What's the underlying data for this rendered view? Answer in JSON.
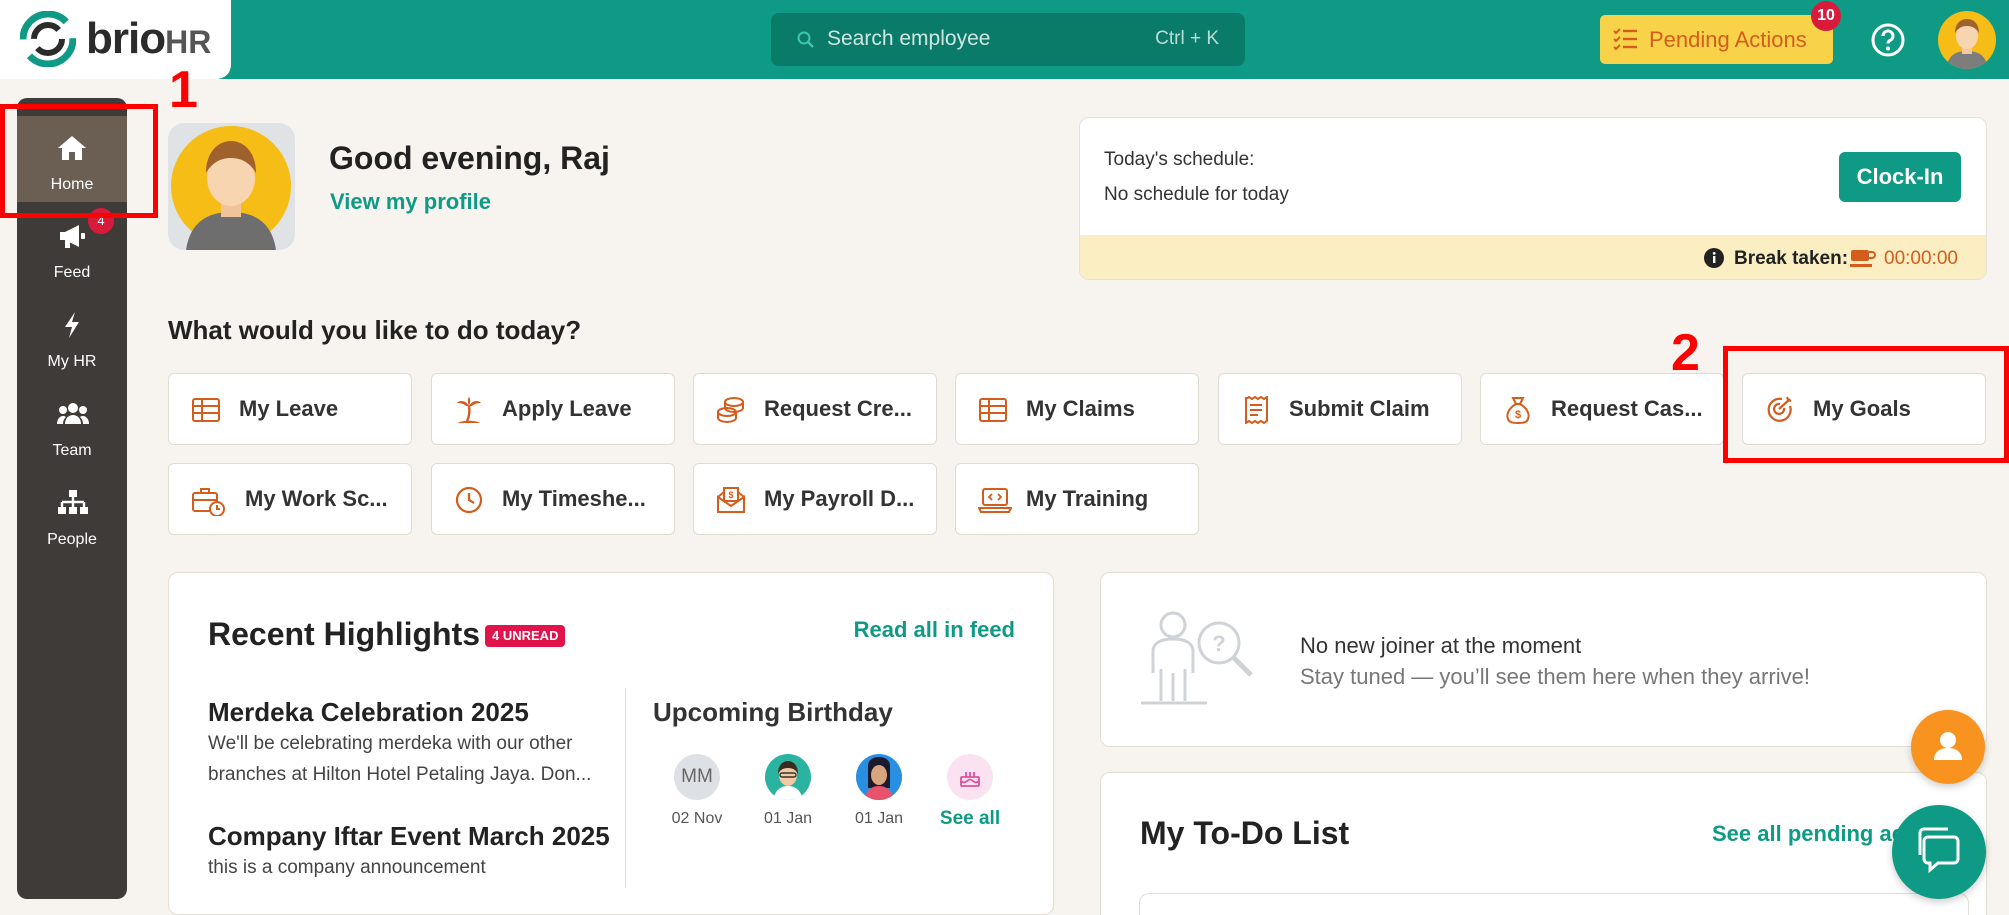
{
  "brand": {
    "name": "brio",
    "suffix": "HR",
    "color": "#0f9a85"
  },
  "topbar": {
    "search_placeholder": "Search employee",
    "search_shortcut": "Ctrl + K",
    "pending_label": "Pending Actions",
    "pending_count": "10",
    "help_icon": "question-circle-icon"
  },
  "sidebar": {
    "items": [
      {
        "label": "Home",
        "icon": "home-icon",
        "active": true
      },
      {
        "label": "Feed",
        "icon": "megaphone-icon",
        "badge": "4"
      },
      {
        "label": "My HR",
        "icon": "lightning-icon"
      },
      {
        "label": "Team",
        "icon": "team-icon"
      },
      {
        "label": "People",
        "icon": "org-chart-icon"
      }
    ]
  },
  "annotations": {
    "marker_1": "1",
    "marker_2": "2",
    "color": "#ff0000"
  },
  "greeting": {
    "text": "Good evening, Raj",
    "profile_link": "View my profile"
  },
  "schedule": {
    "title": "Today's schedule:",
    "detail": "No schedule for today",
    "clock_in": "Clock-In",
    "break_label": "Break taken:",
    "break_time": "00:00:00"
  },
  "quick_actions": {
    "title": "What would you like to do today?",
    "tiles": [
      {
        "label": "My Leave",
        "icon": "table-icon"
      },
      {
        "label": "Apply Leave",
        "icon": "palm-tree-icon"
      },
      {
        "label": "Request Cre...",
        "icon": "coins-icon"
      },
      {
        "label": "My Claims",
        "icon": "table-icon"
      },
      {
        "label": "Submit Claim",
        "icon": "receipt-icon"
      },
      {
        "label": "Request Cas...",
        "icon": "money-bag-icon"
      },
      {
        "label": "My Goals",
        "icon": "target-icon"
      },
      {
        "label": "My Work Sc...",
        "icon": "briefcase-clock-icon"
      },
      {
        "label": "My Timeshe...",
        "icon": "clock-icon"
      },
      {
        "label": "My Payroll D...",
        "icon": "payroll-envelope-icon"
      },
      {
        "label": "My Training",
        "icon": "laptop-code-icon"
      }
    ]
  },
  "highlights": {
    "title": "Recent Highlights",
    "unread": "4 UNREAD",
    "read_all": "Read all in feed",
    "news": [
      {
        "title": "Merdeka Celebration 2025",
        "line1": "We'll be celebrating merdeka with our other",
        "line2": "branches at Hilton Hotel Petaling Jaya. Don..."
      },
      {
        "title": "Company Iftar Event March 2025",
        "line1": "this is a company announcement"
      }
    ],
    "birthday": {
      "title": "Upcoming Birthday",
      "people": [
        {
          "initials": "MM",
          "date": "02 Nov"
        },
        {
          "date": "01 Jan"
        },
        {
          "date": "01 Jan"
        }
      ],
      "see_all": "See all"
    }
  },
  "joiner": {
    "title": "No new joiner at the moment",
    "subtitle": "Stay tuned — you’ll see them here when they arrive!"
  },
  "todo": {
    "title": "My To-Do List",
    "see_all": "See all pending ac"
  }
}
